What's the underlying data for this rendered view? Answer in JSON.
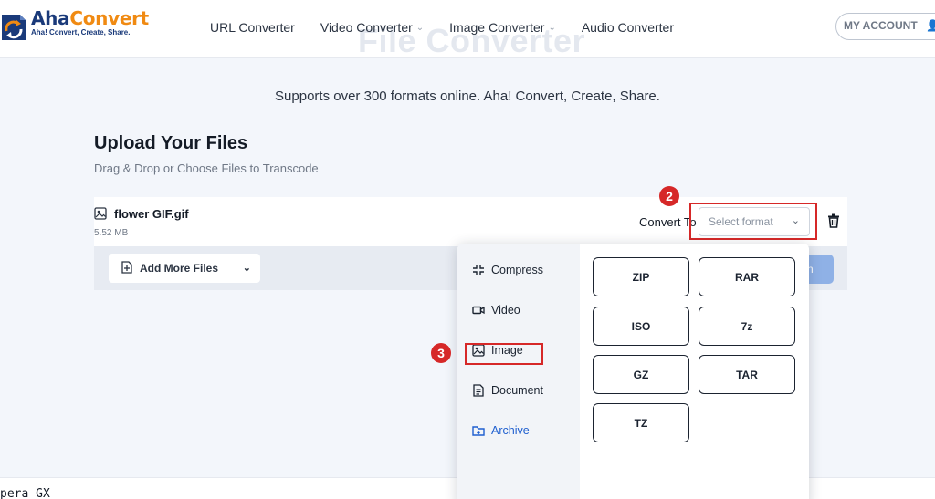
{
  "header": {
    "logo": {
      "name": "AhaConvert",
      "name_part1": "Aha",
      "name_part2": "Convert",
      "tagline": "Aha! Convert, Create, Share."
    },
    "nav": [
      {
        "label": "URL Converter",
        "has_dropdown": false
      },
      {
        "label": "Video Converter",
        "has_dropdown": true
      },
      {
        "label": "Image Converter",
        "has_dropdown": true
      },
      {
        "label": "Audio Converter",
        "has_dropdown": false
      }
    ],
    "ghost_title": "File Converter",
    "account_label": "MY ACCOUNT"
  },
  "hero": {
    "subtitle": "Supports over 300 formats online. Aha! Convert, Create, Share."
  },
  "upload": {
    "title": "Upload Your Files",
    "subtitle": "Drag & Drop or Choose Files to Transcode",
    "file": {
      "name": "flower GIF.gif",
      "size": "5.52 MB"
    },
    "convert_to_label": "Convert To",
    "select_placeholder": "Select format",
    "add_more_label": "Add More Files",
    "convert_button_label": "n"
  },
  "dropdown": {
    "categories": [
      {
        "label": "Compress",
        "icon": "compress-icon",
        "active": false
      },
      {
        "label": "Video",
        "icon": "video-icon",
        "active": false
      },
      {
        "label": "Image",
        "icon": "image-icon",
        "active": false
      },
      {
        "label": "Document",
        "icon": "document-icon",
        "active": false
      },
      {
        "label": "Archive",
        "icon": "archive-icon",
        "active": true
      }
    ],
    "formats": [
      "ZIP",
      "RAR",
      "ISO",
      "7z",
      "GZ",
      "TAR",
      "TZ"
    ]
  },
  "annotations": {
    "step2": "2",
    "step3": "3"
  },
  "bottom_text": "pera GX",
  "colors": {
    "accent": "#1f5fcf",
    "brand_orange": "#f08a12",
    "brand_navy": "#1a3a7a",
    "annotation_red": "#d62828"
  }
}
